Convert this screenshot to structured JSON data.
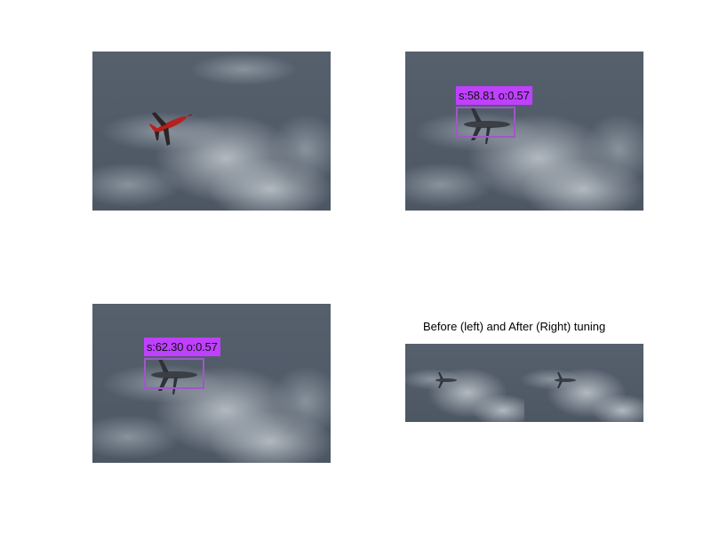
{
  "panels": {
    "original": {
      "jet_color": "red"
    },
    "detection_a": {
      "label": "s:58.81 o:0.57",
      "jet_color": "gray"
    },
    "detection_b": {
      "label": "s:62.30 o:0.57",
      "jet_color": "gray"
    },
    "comparison": {
      "title": "Before (left) and After (Right) tuning"
    }
  },
  "colors": {
    "sky": "#5d6773",
    "cloud": "#a8b0b8",
    "box_border": "#a057c8",
    "label_bg": "#bf40ff",
    "jet_red": "#b72020",
    "jet_gray": "#3b3e44"
  }
}
